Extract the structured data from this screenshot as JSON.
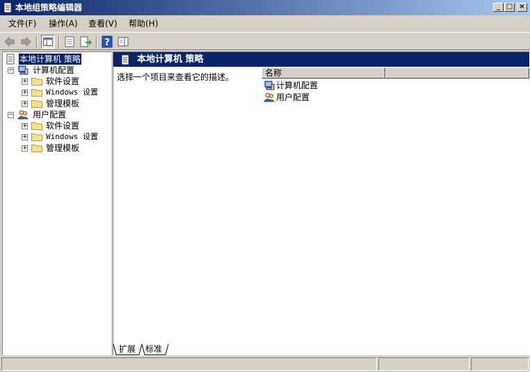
{
  "window": {
    "title": "本地组策略编辑器",
    "icon": "policy-document-icon",
    "controls": {
      "minimize": "_",
      "maximize": "□",
      "close": "×"
    }
  },
  "menu": [
    {
      "label": "文件(F)"
    },
    {
      "label": "操作(A)"
    },
    {
      "label": "查看(V)"
    },
    {
      "label": "帮助(H)"
    }
  ],
  "toolbar": {
    "buttons": [
      "back-arrow-icon",
      "forward-arrow-icon",
      "show-hide-tree-icon",
      "properties-icon",
      "export-list-icon",
      "help-icon",
      "show-hide-action-pane-icon"
    ]
  },
  "tree": {
    "root": "本地计算机 策略",
    "computer": {
      "label": "计算机配置",
      "children": [
        "软件设置",
        "Windows 设置",
        "管理模板"
      ]
    },
    "user": {
      "label": "用户配置",
      "children": [
        "软件设置",
        "Windows 设置",
        "管理模板"
      ]
    }
  },
  "content": {
    "header": "本地计算机 策略",
    "description": "选择一个项目来查看它的描述。",
    "columns": [
      "名称",
      ""
    ],
    "items": [
      "计算机配置",
      "用户配置"
    ]
  },
  "tabs": [
    "扩展",
    "标准"
  ],
  "colors": {
    "title_start": "#0a246a",
    "title_end": "#a6caf0",
    "selection": "#0a246a",
    "chrome": "#d4d0c8"
  }
}
